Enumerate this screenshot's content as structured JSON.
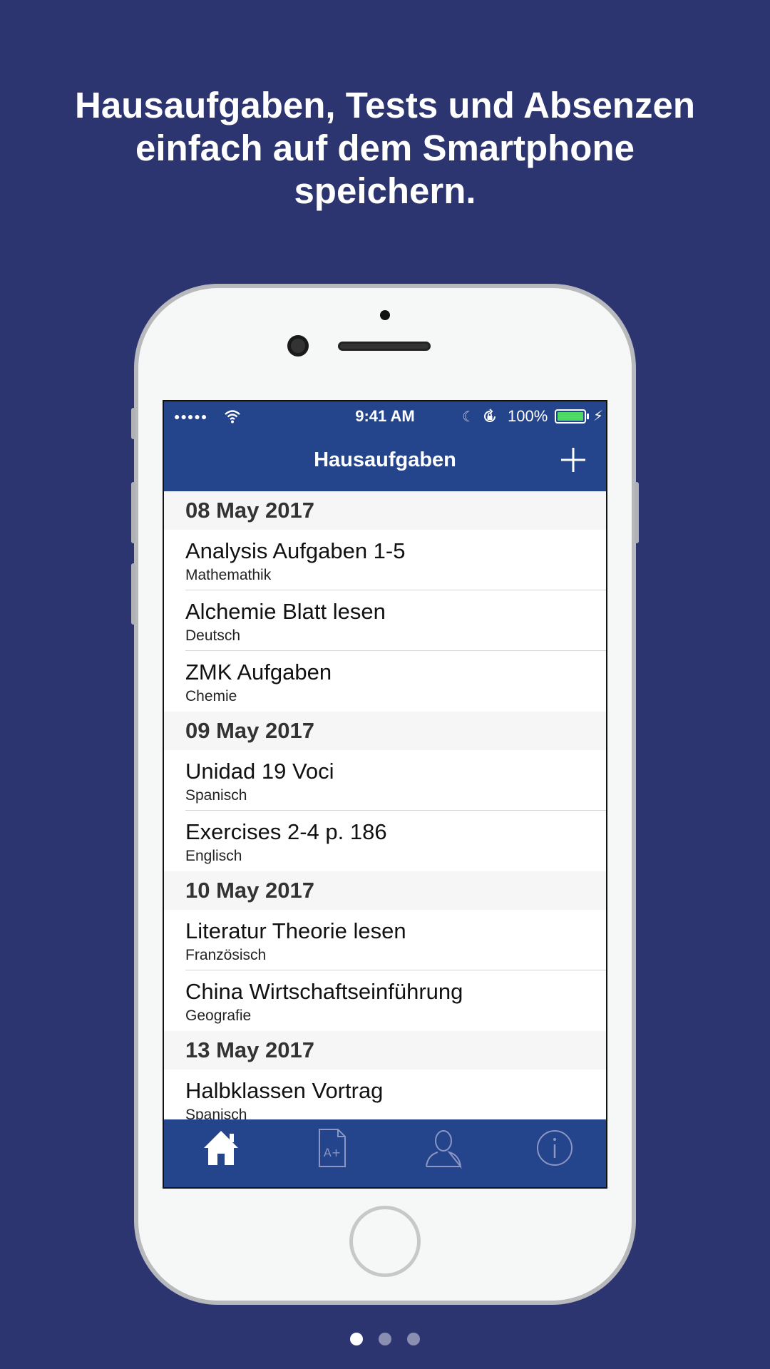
{
  "headline": {
    "line1": "Hausaufgaben, Tests und Absenzen",
    "line2": "einfach auf dem Smartphone",
    "line3": "speichern."
  },
  "status_bar": {
    "signal": "●●●●●",
    "time": "9:41 AM",
    "battery": "100%"
  },
  "nav": {
    "title": "Hausaufgaben",
    "add_icon": "plus-icon"
  },
  "sections": [
    {
      "date": "08 May 2017",
      "items": [
        {
          "title": "Analysis Aufgaben 1-5",
          "subject": "Mathemathik"
        },
        {
          "title": "Alchemie Blatt lesen",
          "subject": "Deutsch"
        },
        {
          "title": "ZMK Aufgaben",
          "subject": "Chemie"
        }
      ]
    },
    {
      "date": "09 May 2017",
      "items": [
        {
          "title": "Unidad 19 Voci",
          "subject": "Spanisch"
        },
        {
          "title": "Exercises 2-4 p. 186",
          "subject": "Englisch"
        }
      ]
    },
    {
      "date": "10 May 2017",
      "items": [
        {
          "title": "Literatur Theorie lesen",
          "subject": "Französisch"
        },
        {
          "title": "China Wirtschaftseinführung",
          "subject": "Geografie"
        }
      ]
    },
    {
      "date": "13 May 2017",
      "items": [
        {
          "title": "Halbklassen Vortrag",
          "subject": "Spanisch"
        }
      ]
    }
  ],
  "tabs": [
    {
      "icon": "home-icon",
      "active": true
    },
    {
      "icon": "grade-document-icon",
      "active": false
    },
    {
      "icon": "person-icon",
      "active": false
    },
    {
      "icon": "info-icon",
      "active": false
    }
  ],
  "pager": {
    "count": 3,
    "active_index": 0
  },
  "colors": {
    "background": "#2c3570",
    "bar": "#24448c",
    "battery": "#4cd964"
  }
}
